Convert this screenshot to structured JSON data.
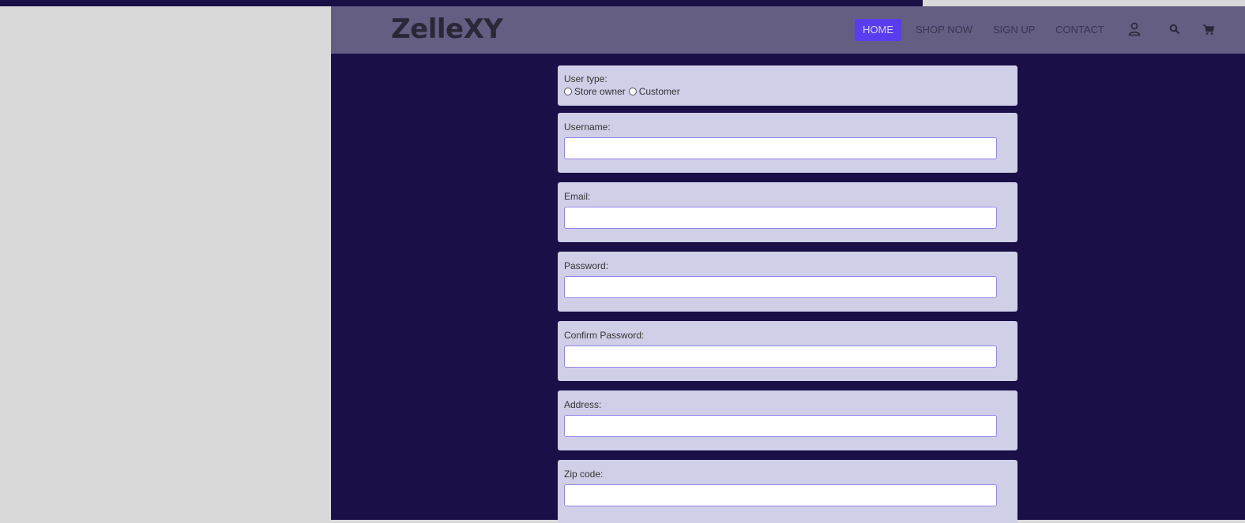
{
  "brand": {
    "name": "ZelleXY"
  },
  "nav": {
    "links": [
      {
        "label": "HOME",
        "active": true
      },
      {
        "label": "SHOP NOW",
        "active": false
      },
      {
        "label": "SIGN UP",
        "active": false
      },
      {
        "label": "CONTACT",
        "active": false
      }
    ],
    "icons": [
      "user-icon",
      "search-icon",
      "cart-icon"
    ]
  },
  "form": {
    "user_type": {
      "label": "User type:",
      "options": [
        "Store owner",
        "Customer"
      ],
      "selected": null
    },
    "fields": [
      {
        "label": "Username:",
        "value": "",
        "placeholder": ""
      },
      {
        "label": "Email:",
        "value": "",
        "placeholder": ""
      },
      {
        "label": "Password:",
        "value": "",
        "placeholder": ""
      },
      {
        "label": "Confirm Password:",
        "value": "",
        "placeholder": ""
      },
      {
        "label": "Address:",
        "value": "",
        "placeholder": ""
      },
      {
        "label": "Zip code:",
        "value": "",
        "placeholder": ""
      }
    ]
  },
  "colors": {
    "page_background": "#1a0f47",
    "navbar": "#635e82",
    "nav_active": "#5b3df0",
    "card": "#d0cfe8",
    "input_border": "#8f86ea",
    "outer_background": "#d9d9d9"
  }
}
